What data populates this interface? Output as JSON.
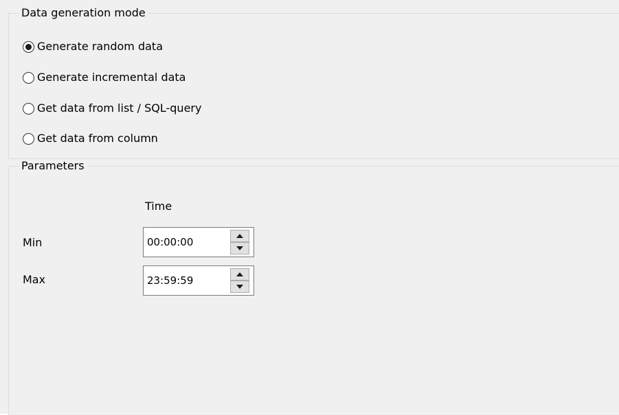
{
  "data_generation_mode": {
    "title": "Data generation mode",
    "options": [
      {
        "label": "Generate random data",
        "checked": true
      },
      {
        "label": "Generate incremental data",
        "checked": false
      },
      {
        "label": "Get data from list / SQL-query",
        "checked": false
      },
      {
        "label": "Get data from column",
        "checked": false
      }
    ]
  },
  "parameters": {
    "title": "Parameters",
    "column_header": "Time",
    "min_label": "Min",
    "min_value": "00:00:00",
    "max_label": "Max",
    "max_value": "23:59:59"
  },
  "icons": {
    "spin_up": "up-arrow-icon",
    "spin_down": "down-arrow-icon"
  }
}
